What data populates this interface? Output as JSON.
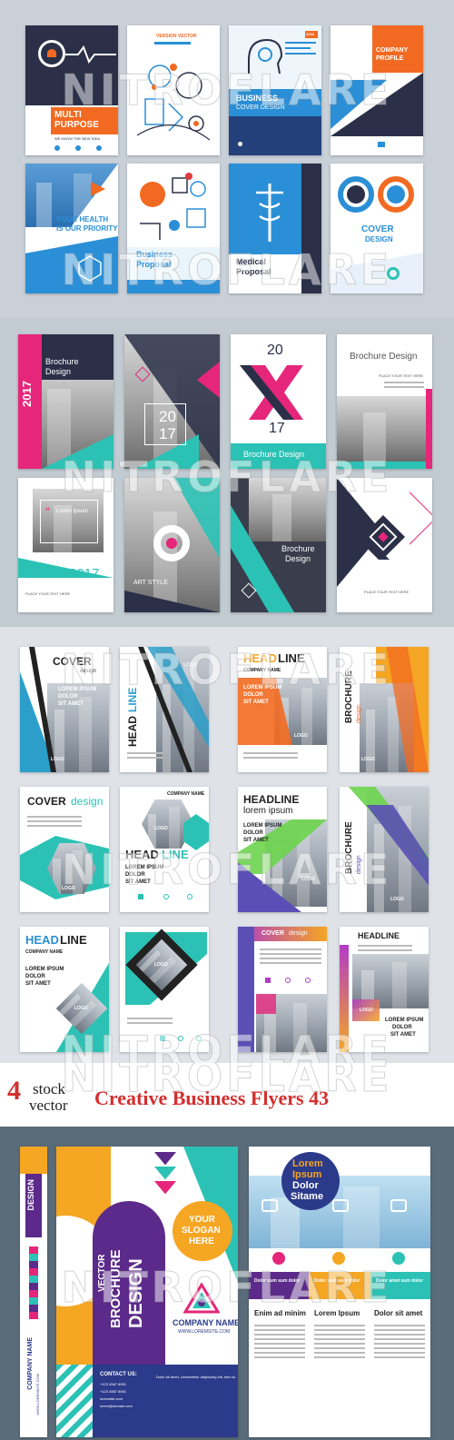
{
  "title": {
    "brand_number": "4",
    "brand_top": "stock",
    "brand_bottom": "vector",
    "text": "Creative Business Flyers 43"
  },
  "watermark": "NITROFLARE",
  "colors": {
    "section1_bg": "#c9d0d8",
    "section2_bg": "#c2cbd2",
    "section3_bg": "#dfe3e8",
    "section4_bg": "#5a6c7a",
    "navy": "#2b3048",
    "orange": "#f26a21",
    "blue": "#2a8fd6",
    "teal": "#2bc2b5",
    "magenta": "#e5267a",
    "title_red": "#d32f2f"
  },
  "section1": {
    "card1": {
      "title_line1": "MULTI",
      "title_line2": "PURPOSE",
      "tagline": "WE KNOW THE NEW IDEA"
    },
    "card2": {
      "header": "VERSION VECTOR"
    },
    "card3": {
      "title_line1": "BUSINESS",
      "title_line2": "COVER DESIGN",
      "year": "2018"
    },
    "card4": {
      "title_line1": "COMPANY",
      "title_line2": "PROFILE"
    },
    "card5": {
      "title_line1": "YOUR HEALTH",
      "title_line2": "IS OUR PRIORITY"
    },
    "card6": {
      "title_line1": "Business",
      "title_line2": "Proposal"
    },
    "card7": {
      "title_line1": "Medical",
      "title_line2": "Proposal"
    },
    "card8": {
      "title_line1": "COVER",
      "title_line2": "DESIGN"
    }
  },
  "section2": {
    "card1": {
      "title_line1": "Brochure",
      "title_line2": "Design",
      "year": "2017"
    },
    "card2": {
      "year_top": "20",
      "year_bottom": "17"
    },
    "card3": {
      "year_top": "20",
      "year_bottom": "17",
      "title": "Brochure Design"
    },
    "card4": {
      "title": "Brochure Design",
      "tagline": "PLACE YOUR TEXT HERE"
    },
    "card5": {
      "quote": "Lorem Ipsum",
      "year": "2017",
      "tagline": "PLACE YOUR TEXT HERE"
    },
    "card6": {
      "title": "ART STYLE"
    },
    "card7": {
      "title_line1": "Brochure",
      "title_line2": "Design"
    },
    "card8": {
      "tagline": "PLACE YOUR TEXT HERE"
    }
  },
  "section3": {
    "s1": {
      "title": "COVER",
      "subtitle": "design",
      "body_line1": "LOREM IPSUM",
      "body_line2": "DOLOR",
      "body_line3": "SIT AMET",
      "logo": "LOGO"
    },
    "s2": {
      "title_part1": "HEAD",
      "title_part2": "LINE",
      "logo": "LOGO"
    },
    "s3": {
      "title_part1": "HEAD",
      "title_part2": "LINE",
      "company": "COMPANY NAME",
      "body_line1": "LOREM IPSUM",
      "body_line2": "DOLOR",
      "body_line3": "SIT AMET",
      "logo": "LOGO"
    },
    "s4": {
      "title": "BROCHURE",
      "subtitle": "design",
      "logo": "LOGO"
    },
    "s5": {
      "title": "COVER",
      "subtitle": "design",
      "logo": "LOGO"
    },
    "s6": {
      "company": "COMPANY NAME",
      "title_part1": "HEAD",
      "title_part2": "LINE",
      "body_line1": "LOREM IPSUM",
      "body_line2": "DOLOR",
      "body_line3": "SIT AMET",
      "logo": "LOGO"
    },
    "s7": {
      "title_line1": "HEADLINE",
      "title_line2": "lorem ipsum",
      "body_line1": "LOREM IPSUM",
      "body_line2": "DOLOR",
      "body_line3": "SIT AMET",
      "logo": "LOGO"
    },
    "s8": {
      "title": "BROCHURE",
      "subtitle": "design",
      "logo": "LOGO"
    },
    "s9": {
      "title_part1": "HEAD",
      "title_part2": "LINE",
      "company": "COMPANY NAME",
      "body_line1": "LOREM IPSUM",
      "body_line2": "DOLOR",
      "body_line3": "SIT AMET",
      "logo": "LOGO"
    },
    "s10": {
      "logo": "LOGO"
    },
    "s11": {
      "title_part1": "COVER",
      "title_part2": "design"
    },
    "s12": {
      "title": "HEADLINE",
      "body_line1": "LOREM IPSUM",
      "body_line2": "DOLOR",
      "body_line3": "SIT AMET",
      "logo": "LOGO"
    }
  },
  "section4": {
    "side": {
      "title": "DESIGN",
      "company": "COMPANY NAME",
      "url": "WWW.LOREMSITE.COM"
    },
    "front": {
      "vertical_line1": "VECTOR",
      "vertical_line2": "BROCHURE",
      "vertical_line3": "DESIGN",
      "slogan_line1": "YOUR",
      "slogan_line2": "SLOGAN",
      "slogan_line3": "HERE",
      "company": "COMPANY NAME",
      "url": "WWW.LOREMSITE.COM",
      "contact_label": "CONTACT US:",
      "phone1": "+123 4567 8901",
      "phone2": "+123 4567 8901",
      "email1": "loremsite.com",
      "email2": "lorem@domain.com",
      "footer_text": "Dolor sit amet, consectetur adipiscing elit, sed do."
    },
    "inner": {
      "heading_line1": "Lorem",
      "heading_line2": "Ipsum",
      "heading_line3": "Dolor",
      "heading_line4": "Sitame",
      "band1": "Dolor sum sum dolor",
      "band2": "Dolor sum sum dolor",
      "band3": "Dolor amet sum dolor",
      "col1_title": "Enim ad minim",
      "col2_title": "Lorem Ipsum",
      "col3_title": "Dolor sit amet"
    }
  }
}
